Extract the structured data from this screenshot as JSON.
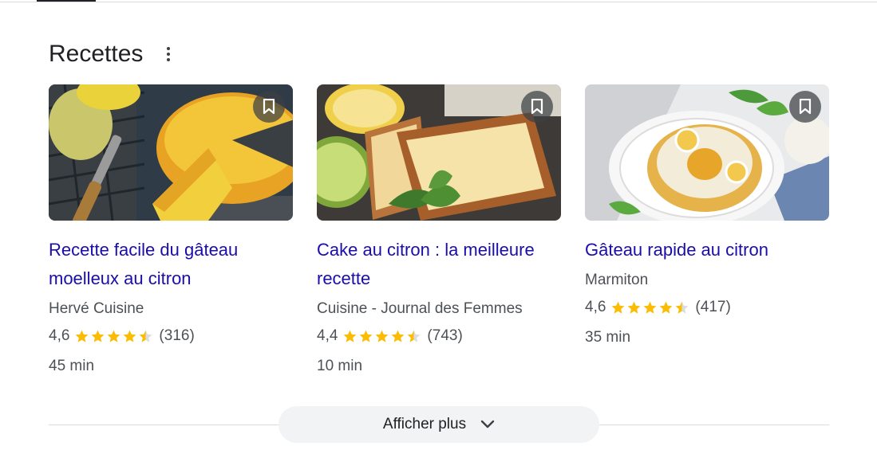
{
  "section": {
    "title": "Recettes"
  },
  "recipes": [
    {
      "title": "Recette facile du gâteau moelleux au citron",
      "source": "Hervé Cuisine",
      "rating": "4,6",
      "rating_value": 4.6,
      "reviews": "(316)",
      "time": "45 min"
    },
    {
      "title": "Cake au citron : la meilleure recette",
      "source": "Cuisine - Journal des Femmes",
      "rating": "4,4",
      "rating_value": 4.4,
      "reviews": "(743)",
      "time": "10 min"
    },
    {
      "title": "Gâteau rapide au citron",
      "source": "Marmiton",
      "rating": "4,6",
      "rating_value": 4.6,
      "reviews": "(417)",
      "time": "35 min"
    }
  ],
  "more": {
    "label": "Afficher plus"
  },
  "colors": {
    "link": "#1a0dab",
    "star": "#fbbc04",
    "star_empty": "#dadce0",
    "button_bg": "#f1f3f4"
  },
  "icons": {
    "menu": "more-vert-icon",
    "save": "bookmark-icon",
    "expand": "chevron-down-icon"
  }
}
